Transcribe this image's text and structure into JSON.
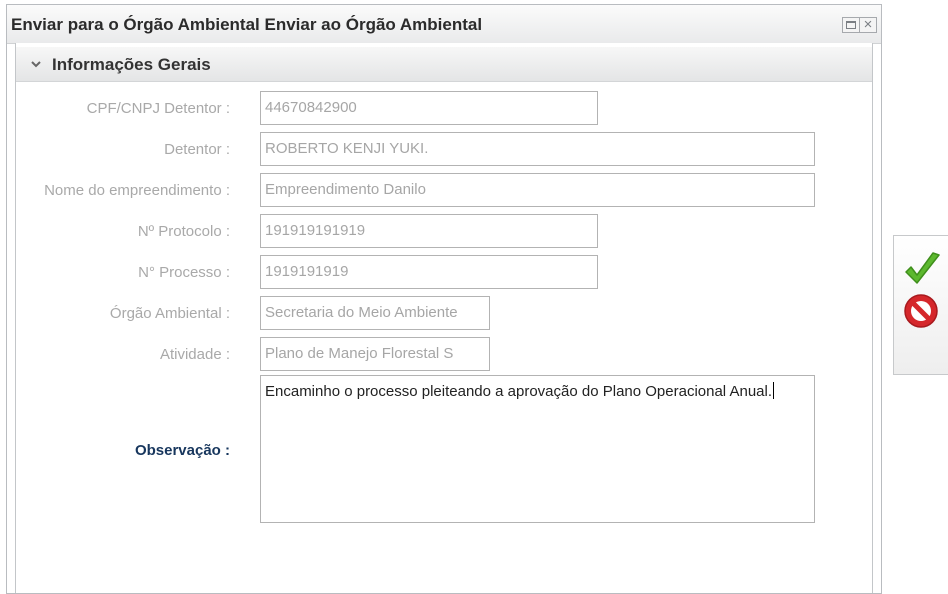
{
  "window": {
    "title": "Enviar para o Órgão Ambiental Enviar ao Órgão Ambiental",
    "tools": [
      {
        "icon": "maximize-icon"
      },
      {
        "icon": "close-icon"
      }
    ]
  },
  "section": {
    "title": "Informações Gerais",
    "icon": "chevron-down-icon",
    "collapsed": false
  },
  "form": {
    "cpf_cnpj": {
      "label": "CPF/CNPJ Detentor :",
      "value": "44670842900"
    },
    "detentor": {
      "label": "Detentor :",
      "value": "ROBERTO KENJI YUKI."
    },
    "empreendimento": {
      "label": "Nome do empreendimento :",
      "value": "Empreendimento Danilo"
    },
    "protocolo": {
      "label": "Nº Protocolo :",
      "value": "191919191919"
    },
    "processo": {
      "label": "N° Processo :",
      "value": "1919191919"
    },
    "orgao": {
      "label": "Órgão Ambiental :",
      "value": "Secretaria do Meio Ambiente"
    },
    "atividade": {
      "label": "Atividade :",
      "value": "Plano de Manejo Florestal S"
    },
    "observacao": {
      "label": "Observação :",
      "value": "Encaminho o processo pleiteando a aprovação do Plano Operacional Anual."
    }
  },
  "actions": {
    "confirm": {
      "icon": "checkmark-icon",
      "color": "#5cb82e"
    },
    "cancel": {
      "icon": "no-entry-icon",
      "color": "#d5272b"
    }
  },
  "colors": {
    "label_disabled": "#a9a9a9",
    "label_active": "#17365d",
    "input_text_disabled": "#a6a6a6",
    "border": "#b3b3b3"
  }
}
